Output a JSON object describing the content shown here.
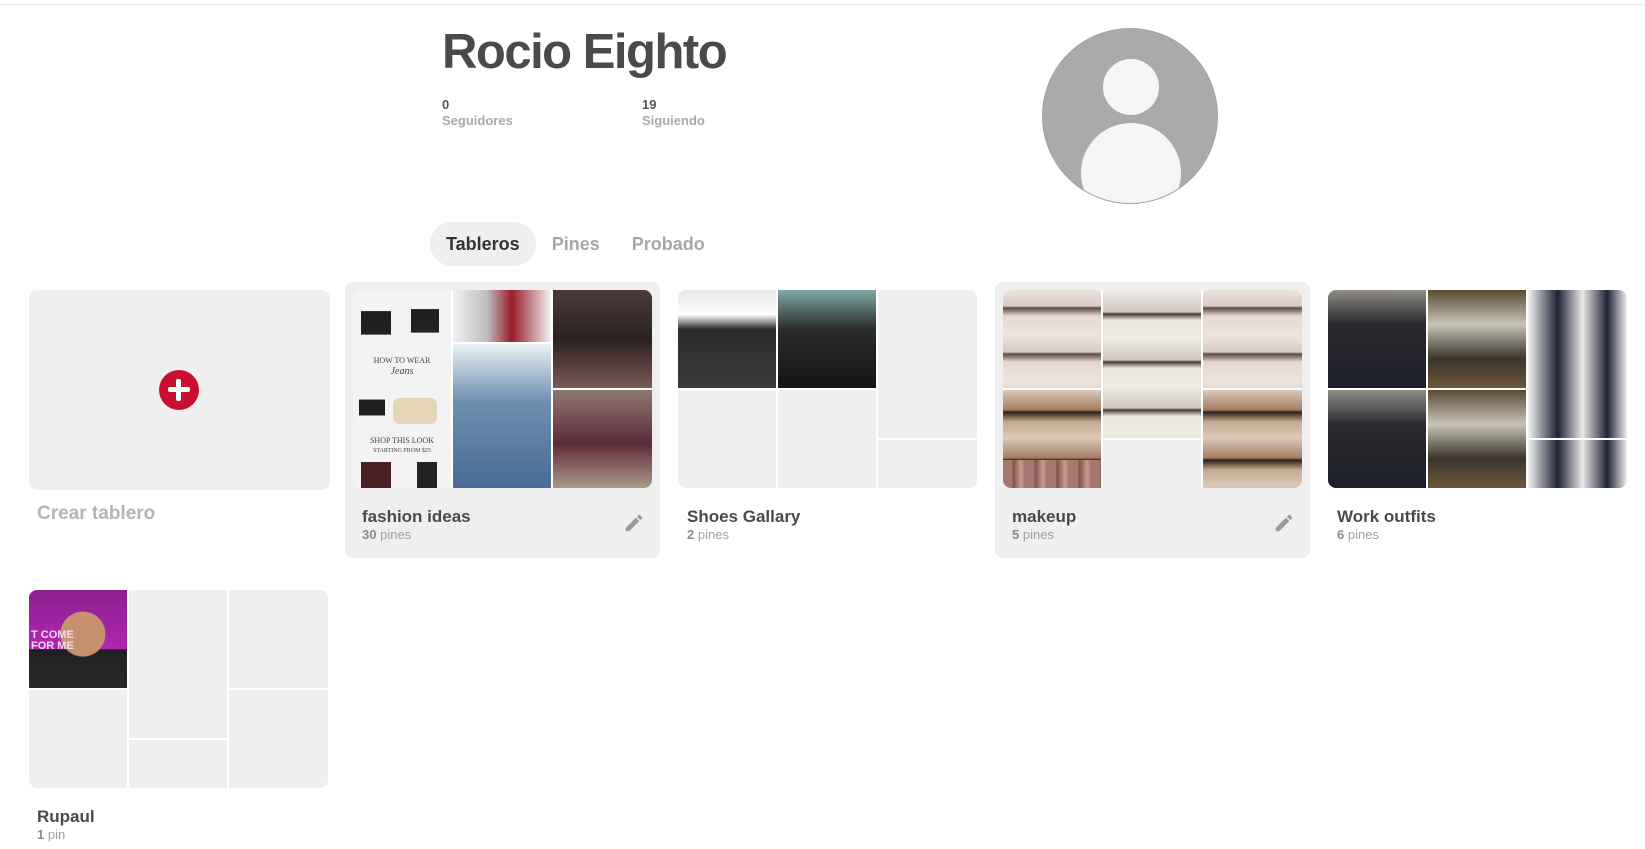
{
  "profile": {
    "name": "Rocio Eighto",
    "followers_count": "0",
    "followers_label": "Seguidores",
    "following_count": "19",
    "following_label": "Siguiendo"
  },
  "tabs": [
    {
      "label": "Tableros",
      "active": true
    },
    {
      "label": "Pines",
      "active": false
    },
    {
      "label": "Probado",
      "active": false
    }
  ],
  "create_board": {
    "label": "Crear tablero",
    "icon": "plus-circle-icon"
  },
  "boards": [
    {
      "title": "fashion ideas",
      "count": "30",
      "unit": "pines",
      "editable": true
    },
    {
      "title": "Shoes Gallary",
      "count": "2",
      "unit": "pines",
      "editable": false
    },
    {
      "title": "makeup",
      "count": "5",
      "unit": "pines",
      "editable": true
    },
    {
      "title": "Work outfits",
      "count": "6",
      "unit": "pines",
      "editable": false
    },
    {
      "title": "Rupaul",
      "count": "1",
      "unit": "pin",
      "editable": false
    }
  ],
  "image_text": {
    "fashion_how_to_wear": "HOW TO WEAR",
    "fashion_jeans": "Jeans",
    "fashion_shop": "SHOP THIS LOOK",
    "fashion_starting": "STARTING FROM $25",
    "rupaul_line1": "T COME",
    "rupaul_line2": "FOR ME"
  },
  "colors": {
    "accent": "#c8102e",
    "tile_bg": "#efefef",
    "muted_text": "#a7a7a7"
  }
}
